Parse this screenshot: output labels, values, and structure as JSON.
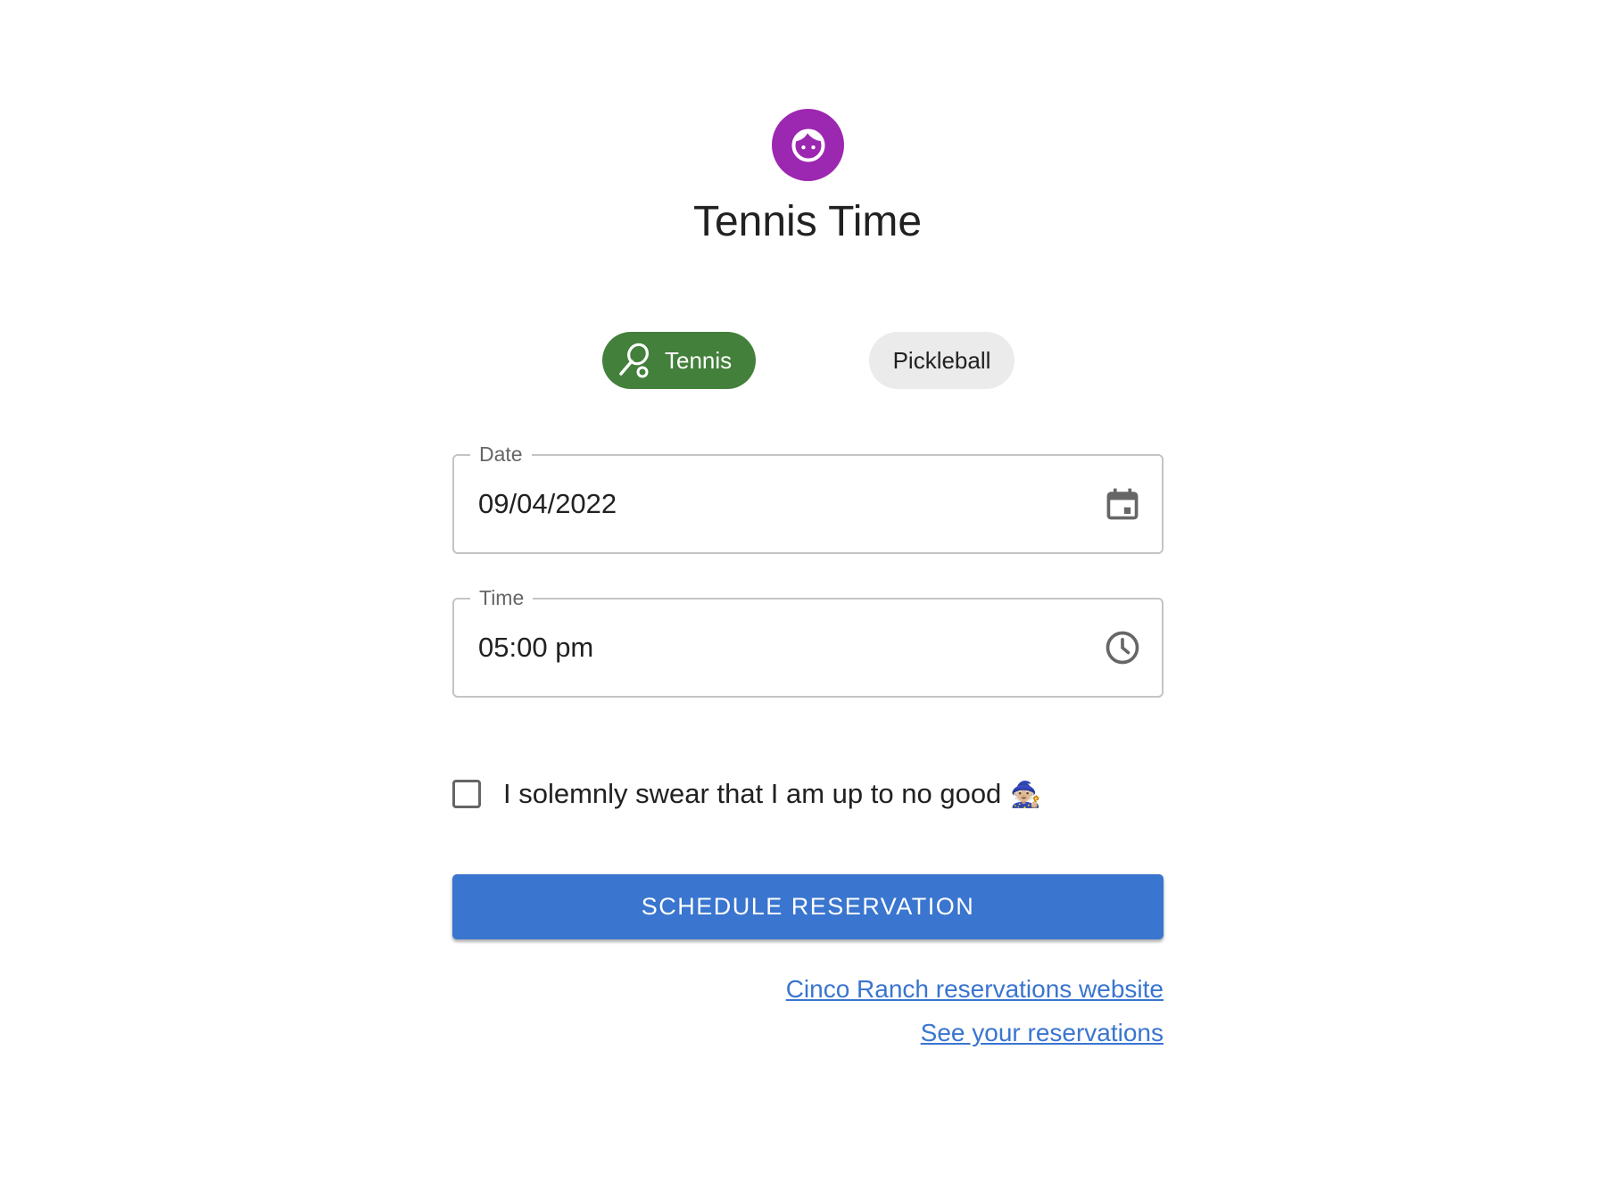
{
  "app": {
    "title": "Tennis Time"
  },
  "sport_selector": {
    "options": [
      {
        "label": "Tennis",
        "selected": true,
        "icon": "tennis-racket-icon"
      },
      {
        "label": "Pickleball",
        "selected": false
      }
    ]
  },
  "form": {
    "date": {
      "label": "Date",
      "value": "09/04/2022",
      "icon": "calendar-icon"
    },
    "time": {
      "label": "Time",
      "value": "05:00 pm",
      "icon": "clock-icon"
    },
    "agreement": {
      "label": "I solemnly swear that I am up to no good",
      "emoji": "🧙🏼",
      "checked": false
    },
    "submit_label": "SCHEDULE RESERVATION"
  },
  "links": {
    "website": "Cinco Ranch reservations website",
    "reservations": "See your reservations"
  },
  "colors": {
    "avatar": "#9c27b0",
    "selected_chip": "#43803b",
    "unselected_chip": "#ebebeb",
    "primary": "#3a75cf"
  }
}
